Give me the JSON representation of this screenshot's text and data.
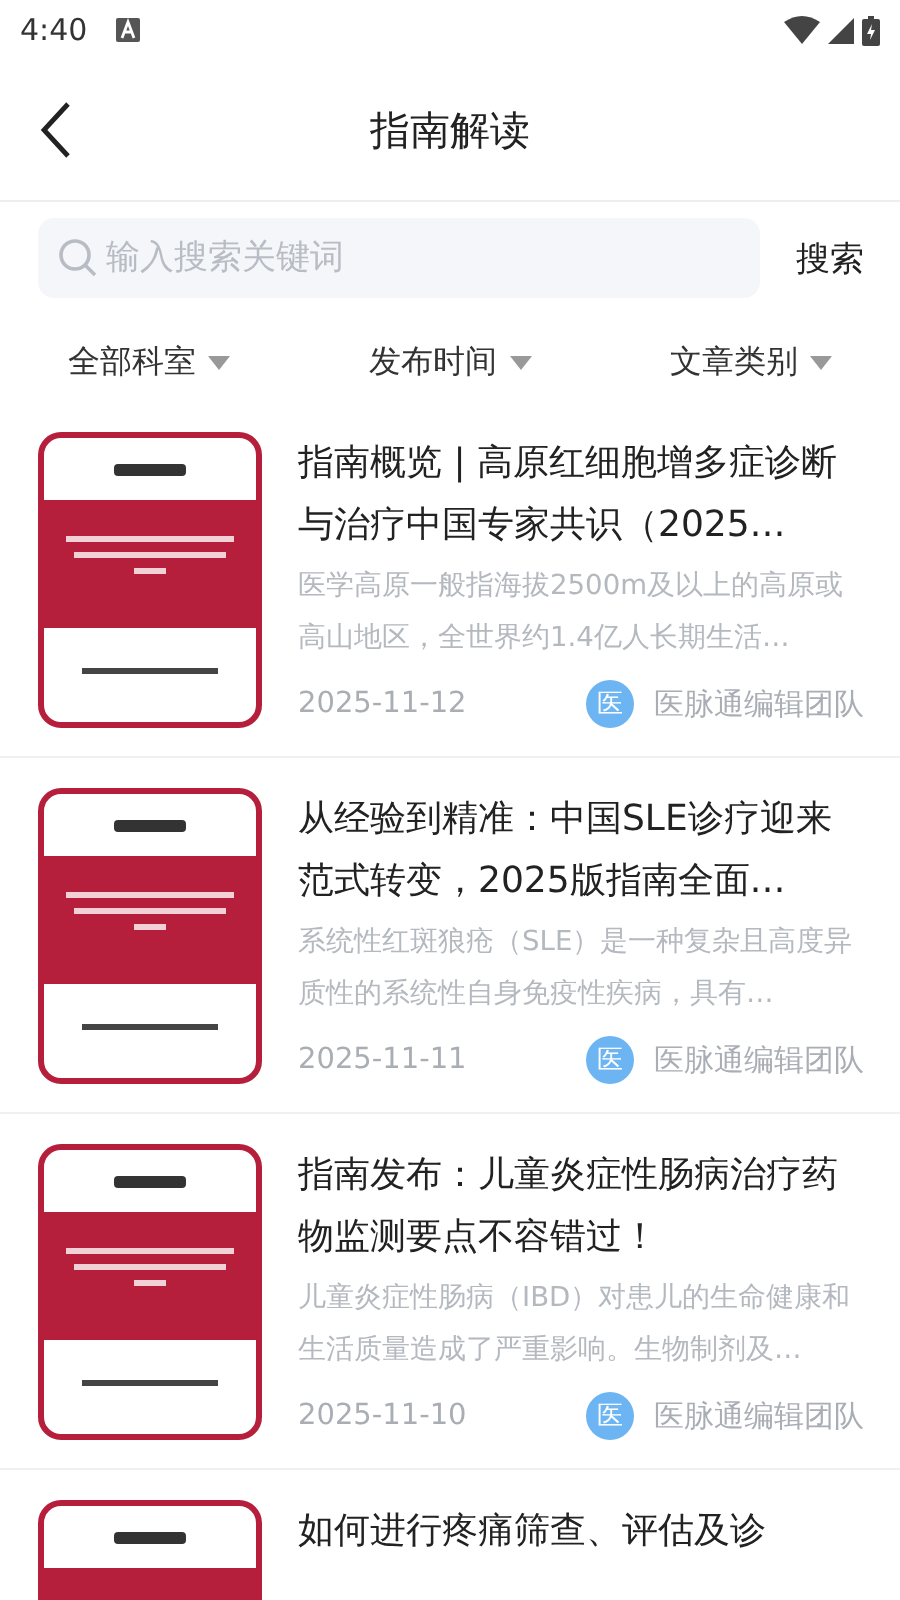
{
  "status_bar": {
    "time": "4:40"
  },
  "header": {
    "title": "指南解读"
  },
  "search": {
    "placeholder": "输入搜索关键词",
    "button": "搜索"
  },
  "filters": [
    {
      "label": "全部科室"
    },
    {
      "label": "发布时间"
    },
    {
      "label": "文章类别"
    }
  ],
  "articles": [
    {
      "title": "指南概览 | 高原红细胞增多症诊断与治疗中国专家共识（2025…",
      "summary": "医学高原一般指海拔2500m及以上的高原或高山地区，全世界约1.4亿人长期生活…",
      "date": "2025-11-12",
      "avatar": "医",
      "author": "医脉通编辑团队"
    },
    {
      "title": "从经验到精准：中国SLE诊疗迎来范式转变，2025版指南全面…",
      "summary": "系统性红斑狼疮（SLE）是一种复杂且高度异质性的系统性自身免疫性疾病，具有…",
      "date": "2025-11-11",
      "avatar": "医",
      "author": "医脉通编辑团队"
    },
    {
      "title": "指南发布：儿童炎症性肠病治疗药物监测要点不容错过！",
      "summary": "儿童炎症性肠病（IBD）对患儿的生命健康和生活质量造成了严重影响。生物制剂及…",
      "date": "2025-11-10",
      "avatar": "医",
      "author": "医脉通编辑团队"
    },
    {
      "title": "如何进行疼痛筛查、评估及诊"
    }
  ]
}
